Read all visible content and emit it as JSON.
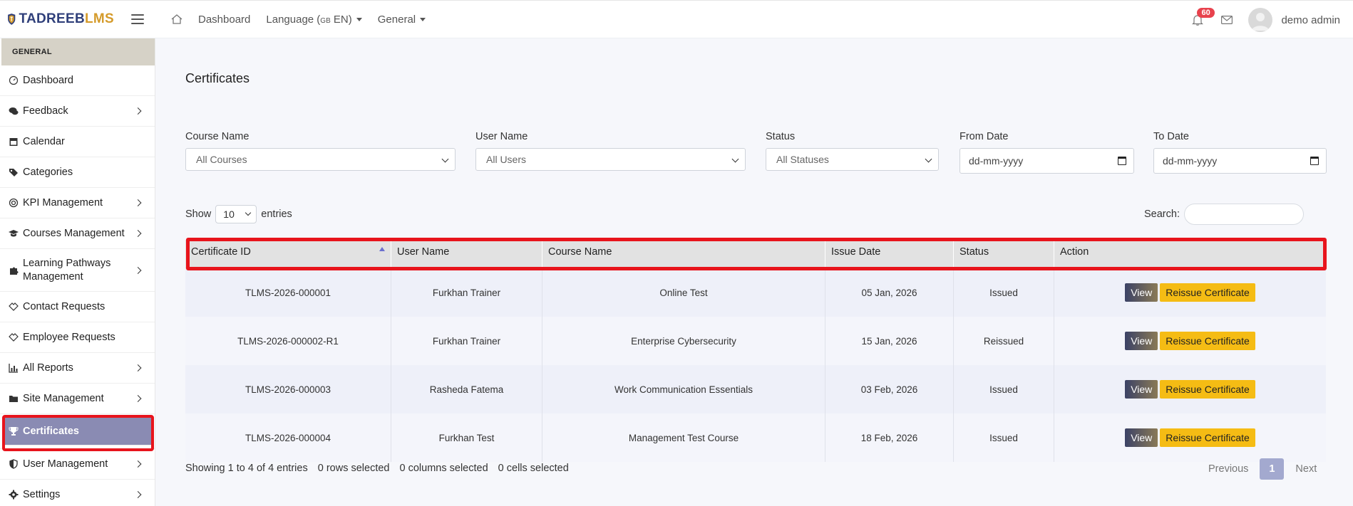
{
  "brand": {
    "part1": "TADREEB",
    "part2": "LMS"
  },
  "topnav": {
    "dashboard": "Dashboard",
    "language_prefix": "Language (",
    "language_flag": "GB",
    "language_suffix": " EN)",
    "general": "General"
  },
  "header_right": {
    "notif_count": "60",
    "user_name": "demo admin"
  },
  "sidebar": {
    "section": "GENERAL",
    "items": [
      {
        "label": "Dashboard",
        "icon": "gauge-icon",
        "chevron": false
      },
      {
        "label": "Feedback",
        "icon": "comments-icon",
        "chevron": true
      },
      {
        "label": "Calendar",
        "icon": "calendar-icon",
        "chevron": false
      },
      {
        "label": "Categories",
        "icon": "tags-icon",
        "chevron": false
      },
      {
        "label": "KPI Management",
        "icon": "target-icon",
        "chevron": true
      },
      {
        "label": "Courses Management",
        "icon": "graduation-cap-icon",
        "chevron": true
      },
      {
        "label": "Learning Pathways Management",
        "icon": "puzzle-icon",
        "chevron": true
      },
      {
        "label": "Contact Requests",
        "icon": "handshake-icon",
        "chevron": false
      },
      {
        "label": "Employee Requests",
        "icon": "handshake-icon",
        "chevron": false
      },
      {
        "label": "All Reports",
        "icon": "chart-icon",
        "chevron": true
      },
      {
        "label": "Site Management",
        "icon": "folder-icon",
        "chevron": true
      },
      {
        "label": "Certificates",
        "icon": "trophy-icon",
        "chevron": false,
        "active": true
      },
      {
        "label": "User Management",
        "icon": "shield-icon",
        "chevron": true
      },
      {
        "label": "Settings",
        "icon": "gear-icon",
        "chevron": true
      }
    ]
  },
  "page": {
    "title": "Certificates"
  },
  "filters": {
    "course_label": "Course Name",
    "course_value": "All Courses",
    "user_label": "User Name",
    "user_value": "All Users",
    "status_label": "Status",
    "status_value": "All Statuses",
    "from_label": "From Date",
    "from_placeholder": "dd-mm-yyyy",
    "to_label": "To Date",
    "to_placeholder": "dd-mm-yyyy"
  },
  "table_controls": {
    "show": "Show",
    "length": "10",
    "entries": "entries",
    "search_label": "Search:"
  },
  "table": {
    "headers": [
      "Certificate ID",
      "User Name",
      "Course Name",
      "Issue Date",
      "Status",
      "Action"
    ],
    "rows": [
      {
        "id": "TLMS-2026-000001",
        "user": "Furkhan Trainer",
        "course": "Online Test",
        "date": "05 Jan, 2026",
        "status": "Issued"
      },
      {
        "id": "TLMS-2026-000002-R1",
        "user": "Furkhan Trainer",
        "course": "Enterprise Cybersecurity",
        "date": "15 Jan, 2026",
        "status": "Reissued"
      },
      {
        "id": "TLMS-2026-000003",
        "user": "Rasheda Fatema",
        "course": "Work Communication Essentials",
        "date": "03 Feb, 2026",
        "status": "Issued"
      },
      {
        "id": "TLMS-2026-000004",
        "user": "Furkhan Test",
        "course": "Management Test Course",
        "date": "18 Feb, 2026",
        "status": "Issued"
      }
    ],
    "view_label": "View",
    "reissue_label": "Reissue Certificate"
  },
  "footer": {
    "showing": "Showing 1 to 4 of 4 entries",
    "rows_sel": "0 rows selected",
    "cols_sel": "0 columns selected",
    "cells_sel": "0 cells selected",
    "prev": "Previous",
    "page": "1",
    "next": "Next"
  }
}
